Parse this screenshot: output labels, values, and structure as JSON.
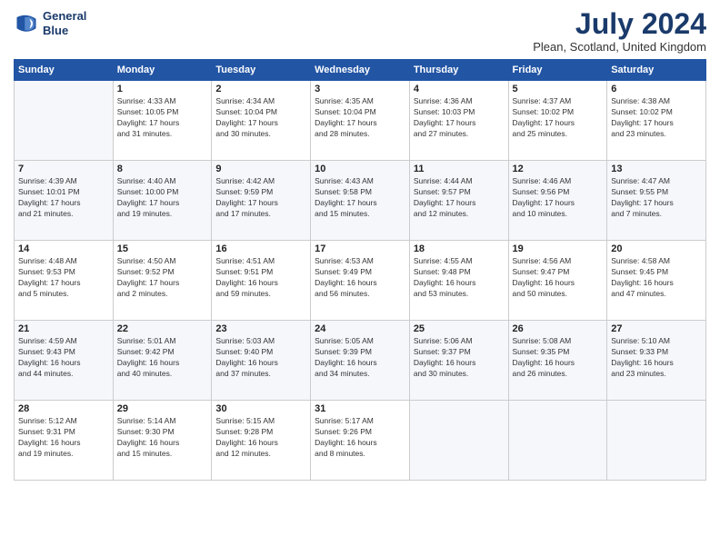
{
  "header": {
    "logo_line1": "General",
    "logo_line2": "Blue",
    "month": "July 2024",
    "location": "Plean, Scotland, United Kingdom"
  },
  "weekdays": [
    "Sunday",
    "Monday",
    "Tuesday",
    "Wednesday",
    "Thursday",
    "Friday",
    "Saturday"
  ],
  "weeks": [
    [
      {
        "day": "",
        "text": ""
      },
      {
        "day": "1",
        "text": "Sunrise: 4:33 AM\nSunset: 10:05 PM\nDaylight: 17 hours\nand 31 minutes."
      },
      {
        "day": "2",
        "text": "Sunrise: 4:34 AM\nSunset: 10:04 PM\nDaylight: 17 hours\nand 30 minutes."
      },
      {
        "day": "3",
        "text": "Sunrise: 4:35 AM\nSunset: 10:04 PM\nDaylight: 17 hours\nand 28 minutes."
      },
      {
        "day": "4",
        "text": "Sunrise: 4:36 AM\nSunset: 10:03 PM\nDaylight: 17 hours\nand 27 minutes."
      },
      {
        "day": "5",
        "text": "Sunrise: 4:37 AM\nSunset: 10:02 PM\nDaylight: 17 hours\nand 25 minutes."
      },
      {
        "day": "6",
        "text": "Sunrise: 4:38 AM\nSunset: 10:02 PM\nDaylight: 17 hours\nand 23 minutes."
      }
    ],
    [
      {
        "day": "7",
        "text": "Sunrise: 4:39 AM\nSunset: 10:01 PM\nDaylight: 17 hours\nand 21 minutes."
      },
      {
        "day": "8",
        "text": "Sunrise: 4:40 AM\nSunset: 10:00 PM\nDaylight: 17 hours\nand 19 minutes."
      },
      {
        "day": "9",
        "text": "Sunrise: 4:42 AM\nSunset: 9:59 PM\nDaylight: 17 hours\nand 17 minutes."
      },
      {
        "day": "10",
        "text": "Sunrise: 4:43 AM\nSunset: 9:58 PM\nDaylight: 17 hours\nand 15 minutes."
      },
      {
        "day": "11",
        "text": "Sunrise: 4:44 AM\nSunset: 9:57 PM\nDaylight: 17 hours\nand 12 minutes."
      },
      {
        "day": "12",
        "text": "Sunrise: 4:46 AM\nSunset: 9:56 PM\nDaylight: 17 hours\nand 10 minutes."
      },
      {
        "day": "13",
        "text": "Sunrise: 4:47 AM\nSunset: 9:55 PM\nDaylight: 17 hours\nand 7 minutes."
      }
    ],
    [
      {
        "day": "14",
        "text": "Sunrise: 4:48 AM\nSunset: 9:53 PM\nDaylight: 17 hours\nand 5 minutes."
      },
      {
        "day": "15",
        "text": "Sunrise: 4:50 AM\nSunset: 9:52 PM\nDaylight: 17 hours\nand 2 minutes."
      },
      {
        "day": "16",
        "text": "Sunrise: 4:51 AM\nSunset: 9:51 PM\nDaylight: 16 hours\nand 59 minutes."
      },
      {
        "day": "17",
        "text": "Sunrise: 4:53 AM\nSunset: 9:49 PM\nDaylight: 16 hours\nand 56 minutes."
      },
      {
        "day": "18",
        "text": "Sunrise: 4:55 AM\nSunset: 9:48 PM\nDaylight: 16 hours\nand 53 minutes."
      },
      {
        "day": "19",
        "text": "Sunrise: 4:56 AM\nSunset: 9:47 PM\nDaylight: 16 hours\nand 50 minutes."
      },
      {
        "day": "20",
        "text": "Sunrise: 4:58 AM\nSunset: 9:45 PM\nDaylight: 16 hours\nand 47 minutes."
      }
    ],
    [
      {
        "day": "21",
        "text": "Sunrise: 4:59 AM\nSunset: 9:43 PM\nDaylight: 16 hours\nand 44 minutes."
      },
      {
        "day": "22",
        "text": "Sunrise: 5:01 AM\nSunset: 9:42 PM\nDaylight: 16 hours\nand 40 minutes."
      },
      {
        "day": "23",
        "text": "Sunrise: 5:03 AM\nSunset: 9:40 PM\nDaylight: 16 hours\nand 37 minutes."
      },
      {
        "day": "24",
        "text": "Sunrise: 5:05 AM\nSunset: 9:39 PM\nDaylight: 16 hours\nand 34 minutes."
      },
      {
        "day": "25",
        "text": "Sunrise: 5:06 AM\nSunset: 9:37 PM\nDaylight: 16 hours\nand 30 minutes."
      },
      {
        "day": "26",
        "text": "Sunrise: 5:08 AM\nSunset: 9:35 PM\nDaylight: 16 hours\nand 26 minutes."
      },
      {
        "day": "27",
        "text": "Sunrise: 5:10 AM\nSunset: 9:33 PM\nDaylight: 16 hours\nand 23 minutes."
      }
    ],
    [
      {
        "day": "28",
        "text": "Sunrise: 5:12 AM\nSunset: 9:31 PM\nDaylight: 16 hours\nand 19 minutes."
      },
      {
        "day": "29",
        "text": "Sunrise: 5:14 AM\nSunset: 9:30 PM\nDaylight: 16 hours\nand 15 minutes."
      },
      {
        "day": "30",
        "text": "Sunrise: 5:15 AM\nSunset: 9:28 PM\nDaylight: 16 hours\nand 12 minutes."
      },
      {
        "day": "31",
        "text": "Sunrise: 5:17 AM\nSunset: 9:26 PM\nDaylight: 16 hours\nand 8 minutes."
      },
      {
        "day": "",
        "text": ""
      },
      {
        "day": "",
        "text": ""
      },
      {
        "day": "",
        "text": ""
      }
    ]
  ]
}
